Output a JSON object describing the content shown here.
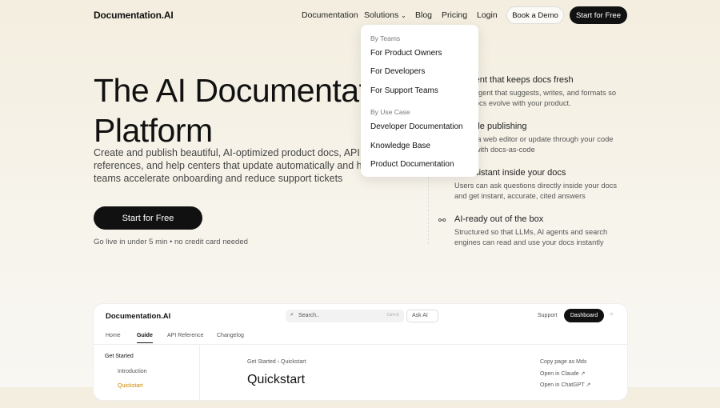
{
  "header": {
    "logo": "Documentation.AI",
    "nav": [
      "Documentation",
      "Solutions",
      "Blog",
      "Pricing",
      "Login"
    ],
    "demo": "Book a Demo",
    "start": "Start for Free"
  },
  "dropdown": {
    "teams_heading": "By Teams",
    "teams": [
      "For Product Owners",
      "For Developers",
      "For Support Teams"
    ],
    "usecase_heading": "By Use Case",
    "usecases": [
      "Developer Documentation",
      "Knowledge Base",
      "Product Documentation"
    ]
  },
  "hero": {
    "title": "The AI Documentation Platform",
    "subtitle": "Create and publish beautiful, AI-optimized product docs, API references, and help centers that update automatically and help teams accelerate onboarding and reduce support tickets",
    "cta": "Start for Free",
    "note": "Go live in under 5 min • no credit card needed"
  },
  "features": [
    {
      "icon": "sparkle-icon",
      "title": "AI agent that keeps docs fresh",
      "desc": "An AI agent that suggests, writes, and formats so your docs evolve with your product."
    },
    {
      "icon": "pencil-icon",
      "title": "Flexible publishing",
      "desc": "Edit in a web editor or update through your code editor with docs-as-code"
    },
    {
      "icon": "chat-icon",
      "title": "AI assistant inside your docs",
      "desc": "Users can ask questions directly inside your docs and get instant, accurate, cited answers"
    },
    {
      "icon": "nodes-icon",
      "title": "AI-ready out of the box",
      "desc": "Structured so that LLMs, AI agents and search engines can read and use your docs instantly"
    }
  ],
  "preview": {
    "logo": "Documentation.AI",
    "search": "Search..",
    "shortcut": "Ctrl+K",
    "ask": "Ask AI",
    "support": "Support",
    "dashboard": "Dashboard",
    "tabs": [
      "Home",
      "Guide",
      "API Reference",
      "Changelog"
    ],
    "section": "Get Started",
    "items": [
      "Introduction",
      "Quickstart"
    ],
    "breadcrumb": "Get Started › Quickstart",
    "page_title": "Quickstart",
    "actions": [
      "Copy page as Mdx",
      "Open in Claude ↗",
      "Open in ChatGPT ↗"
    ]
  }
}
